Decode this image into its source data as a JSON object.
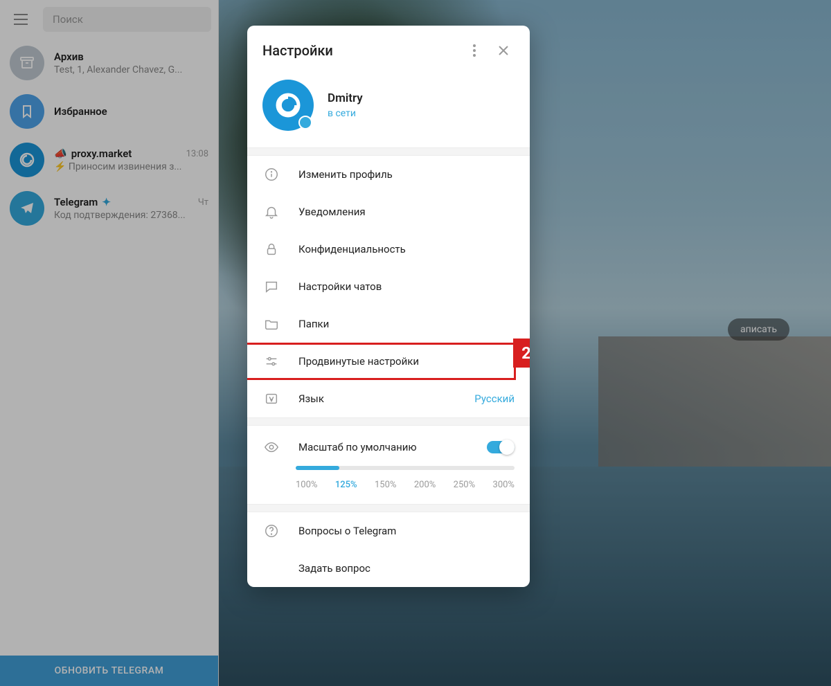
{
  "sidebar": {
    "search_placeholder": "Поиск",
    "update_button": "ОБНОВИТЬ TELEGRAM",
    "chats": [
      {
        "name": "Архив",
        "preview": "Test, 1, Alexander Chavez, G...",
        "time": ""
      },
      {
        "name": "Избранное",
        "preview": "",
        "time": ""
      },
      {
        "name": "proxy.market",
        "preview": "⚡ Приносим извинения з...",
        "time": "13:08"
      },
      {
        "name": "Telegram",
        "preview": "Код подтверждения: 27368...",
        "time": "Чт"
      }
    ]
  },
  "main": {
    "chip": "аписать"
  },
  "modal": {
    "title": "Настройки",
    "profile": {
      "name": "Dmitry",
      "status": "в сети"
    },
    "items": [
      {
        "label": "Изменить профиль"
      },
      {
        "label": "Уведомления"
      },
      {
        "label": "Конфиденциальность"
      },
      {
        "label": "Настройки чатов"
      },
      {
        "label": "Папки"
      },
      {
        "label": "Продвинутые настройки"
      },
      {
        "label": "Язык",
        "value": "Русский"
      }
    ],
    "scale": {
      "label": "Масштаб по умолчанию",
      "options": [
        "100%",
        "125%",
        "150%",
        "200%",
        "250%",
        "300%"
      ],
      "active": "125%"
    },
    "help": [
      {
        "label": "Вопросы о Telegram"
      },
      {
        "label": "Задать вопрос"
      }
    ],
    "annotation_badge": "2"
  }
}
